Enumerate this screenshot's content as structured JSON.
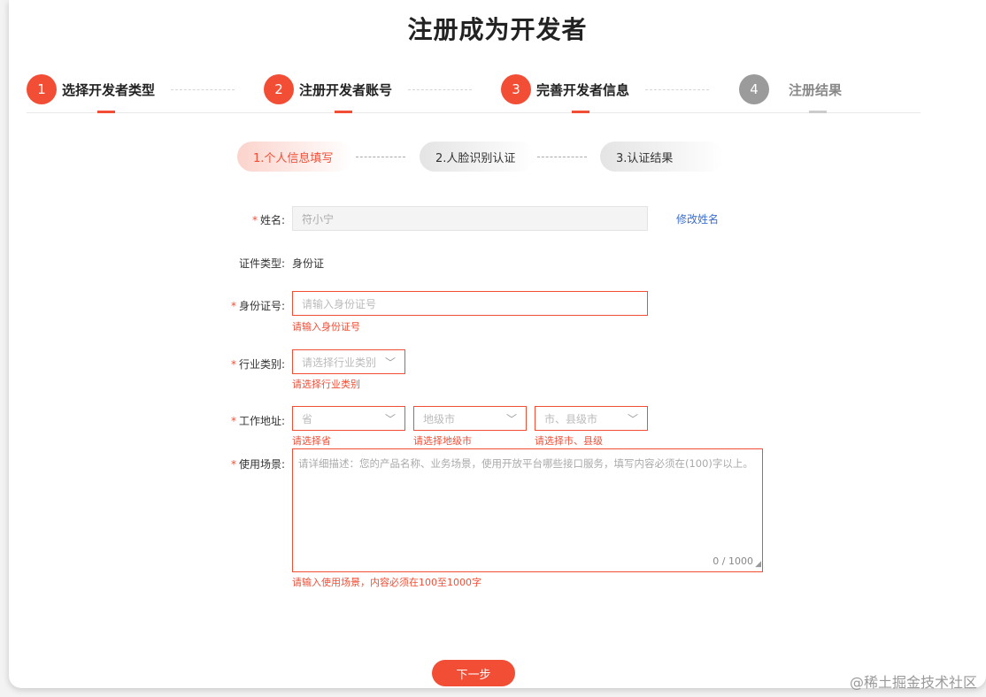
{
  "header": {
    "title": "注册成为开发者"
  },
  "steps": [
    {
      "num": "1",
      "label": "选择开发者类型"
    },
    {
      "num": "2",
      "label": "注册开发者账号"
    },
    {
      "num": "3",
      "label": "完善开发者信息"
    },
    {
      "num": "4",
      "label": "注册结果"
    }
  ],
  "sub_steps": [
    {
      "label": "1.个人信息填写"
    },
    {
      "label": "2.人脸识别认证"
    },
    {
      "label": "3.认证结果"
    }
  ],
  "form": {
    "required_mark": "*",
    "name": {
      "label": "姓名:",
      "value": "符小宁",
      "edit_label": "修改姓名"
    },
    "id_type": {
      "label": "证件类型:",
      "value": "身份证"
    },
    "id_number": {
      "label": "身份证号:",
      "placeholder": "请输入身份证号",
      "error": "请输入身份证号"
    },
    "industry": {
      "label": "行业类别:",
      "placeholder": "请选择行业类别",
      "error": "请选择行业类别"
    },
    "address": {
      "label": "工作地址:",
      "province": {
        "placeholder": "省",
        "error": "请选择省"
      },
      "city": {
        "placeholder": "地级市",
        "error": "请选择地级市"
      },
      "county": {
        "placeholder": "市、县级市",
        "error": "请选择市、县级"
      }
    },
    "scenario": {
      "label": "使用场景:",
      "placeholder": "请详细描述：您的产品名称、业务场景，使用开放平台哪些接口服务，填写内容必须在(100)字以上。",
      "counter": "0 / 1000",
      "error": "请输入使用场景，内容必须在100至1000字"
    }
  },
  "next_button": "下一步",
  "watermark": "@稀土掘金技术社区"
}
